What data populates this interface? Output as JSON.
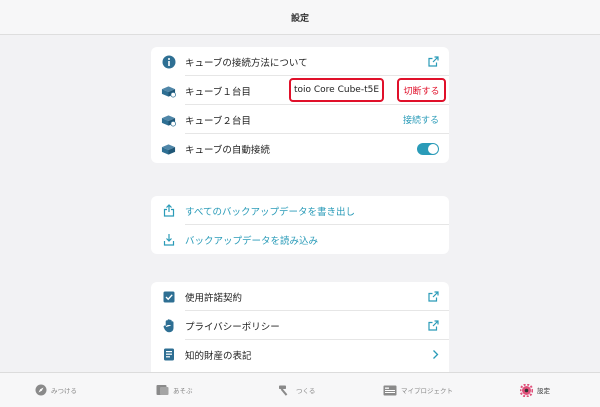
{
  "header": {
    "title": "設定"
  },
  "cube_section": {
    "rows": [
      {
        "label": "キューブの接続方法について"
      },
      {
        "label": "キューブ１台目",
        "device_name": "toio Core Cube-t5E",
        "action": "切断する"
      },
      {
        "label": "キューブ２台目",
        "action": "接続する"
      },
      {
        "label": "キューブの自動接続",
        "toggle_on": true
      }
    ]
  },
  "backup_section": {
    "rows": [
      {
        "label": "すべてのバックアップデータを書き出し"
      },
      {
        "label": "バックアップデータを読み込み"
      }
    ]
  },
  "legal_section": {
    "rows": [
      {
        "label": "使用許諾契約"
      },
      {
        "label": "プライバシーポリシー"
      },
      {
        "label": "知的財産の表記"
      }
    ]
  },
  "tabbar": {
    "tabs": [
      {
        "label": "みつける"
      },
      {
        "label": "あそぶ"
      },
      {
        "label": "つくる"
      },
      {
        "label": "マイプロジェクト"
      },
      {
        "label": "設定"
      }
    ]
  },
  "colors": {
    "accent": "#2a9bb8",
    "highlight": "#e0102a",
    "active_tab": "#e0507a"
  }
}
